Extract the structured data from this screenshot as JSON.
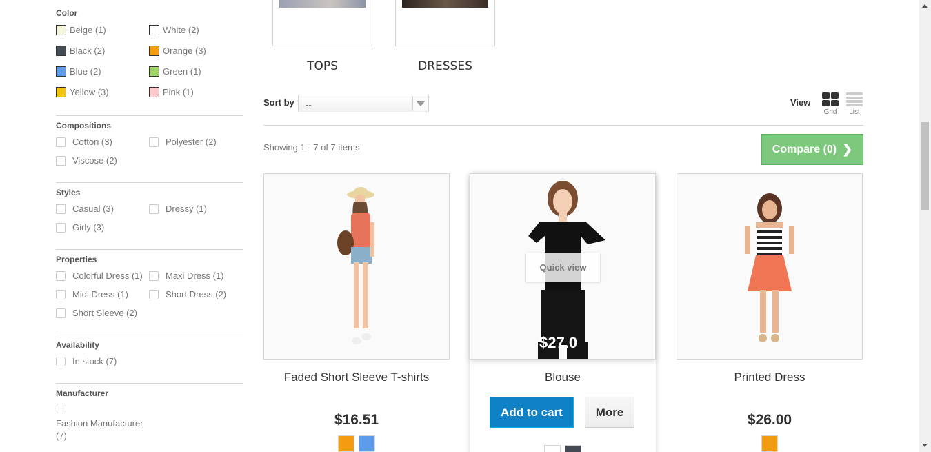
{
  "sidebar": {
    "color": {
      "title": "Color",
      "options": [
        {
          "label": "Beige (1)",
          "color": "#f5f5dc"
        },
        {
          "label": "White (2)",
          "color": "#ffffff"
        },
        {
          "label": "Black (2)",
          "color": "#434a54"
        },
        {
          "label": "Orange (3)",
          "color": "#f39c11"
        },
        {
          "label": "Blue (2)",
          "color": "#5d9cec"
        },
        {
          "label": "Green (1)",
          "color": "#a0d468"
        },
        {
          "label": "Yellow (3)",
          "color": "#f1c40f"
        },
        {
          "label": "Pink (1)",
          "color": "#fccacd"
        }
      ]
    },
    "compositions": {
      "title": "Compositions",
      "options": [
        "Cotton (3)",
        "Polyester (2)",
        "Viscose (2)"
      ]
    },
    "styles": {
      "title": "Styles",
      "options": [
        "Casual (3)",
        "Dressy (1)",
        "Girly (3)"
      ]
    },
    "properties": {
      "title": "Properties",
      "options": [
        "Colorful Dress (1)",
        "Maxi Dress (1)",
        "Midi Dress (1)",
        "Short Dress (2)",
        "Short Sleeve (2)"
      ]
    },
    "availability": {
      "title": "Availability",
      "options": [
        "In stock (7)"
      ]
    },
    "manufacturer": {
      "title": "Manufacturer",
      "option_line1": "Fashion Manufacturer",
      "option_line2": "(7)"
    }
  },
  "subcategories": [
    "TOPS",
    "DRESSES"
  ],
  "sort": {
    "label": "Sort by",
    "value": "--"
  },
  "view": {
    "label": "View",
    "grid": "Grid",
    "list": "List"
  },
  "showing": "Showing 1 - 7 of 7 items",
  "compare": {
    "label": "Compare (0)"
  },
  "products": [
    {
      "name": "Faded Short Sleeve T-shirts",
      "price": "$16.51",
      "colors": [
        "#f39c11",
        "#5d9cec"
      ]
    },
    {
      "name": "Blouse",
      "price": "$27.00",
      "img_price": "$27.0",
      "quick_view": "Quick view",
      "add_to_cart": "Add to cart",
      "more": "More",
      "colors": [
        "#ffffff",
        "#434a54"
      ]
    },
    {
      "name": "Printed Dress",
      "price": "$26.00",
      "colors": [
        "#f39c11"
      ]
    }
  ]
}
